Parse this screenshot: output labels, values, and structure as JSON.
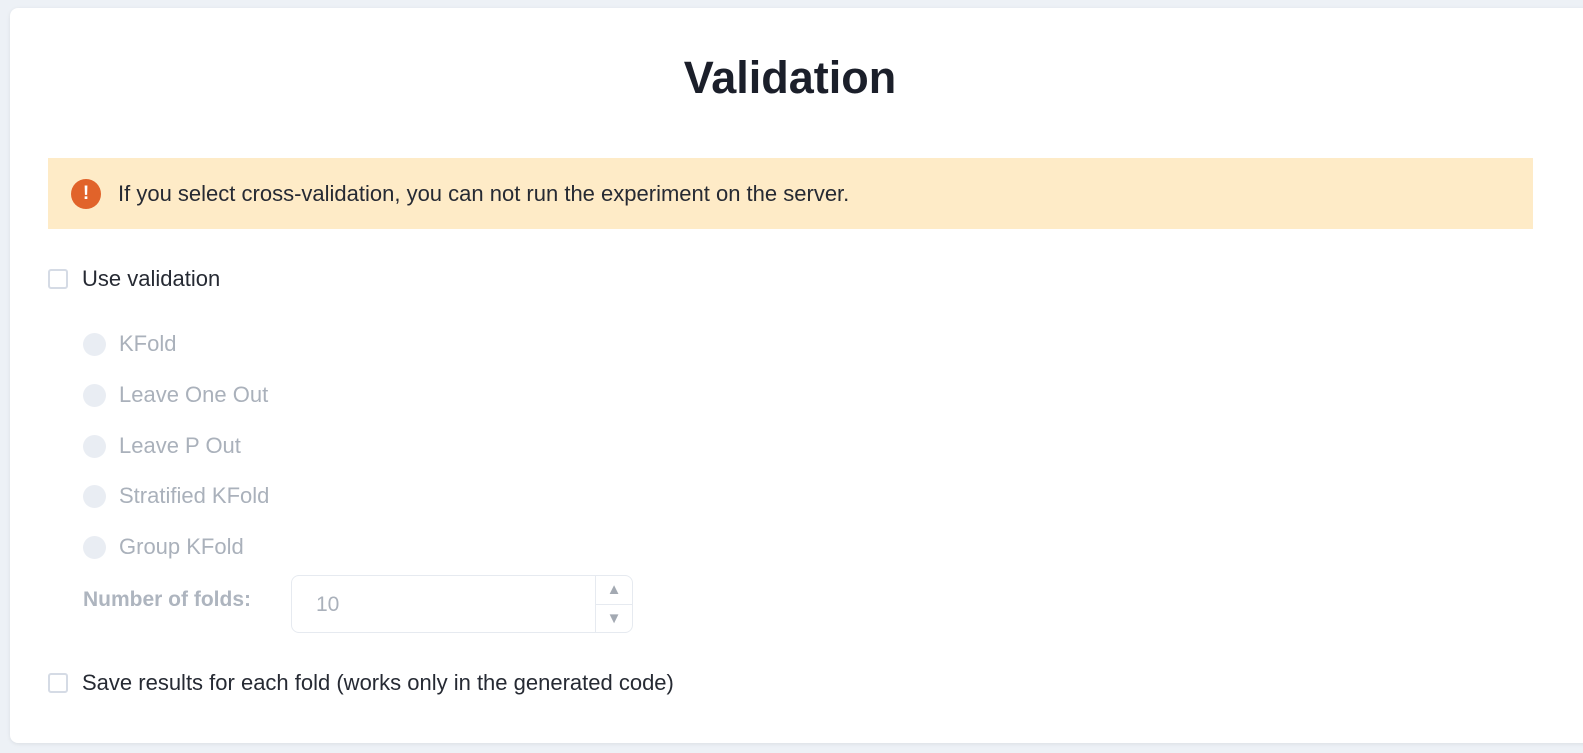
{
  "page": {
    "title": "Validation"
  },
  "alert": {
    "icon": "exclamation-icon",
    "icon_glyph": "!",
    "text": "If you select cross-validation, you can not run the experiment on the server.",
    "bg_color": "#feebc7",
    "icon_color": "#e1632a"
  },
  "use_validation": {
    "label": "Use validation",
    "checked": false
  },
  "methods": {
    "disabled": true,
    "options": [
      {
        "label": "KFold",
        "selected": false
      },
      {
        "label": "Leave One Out",
        "selected": false
      },
      {
        "label": "Leave P Out",
        "selected": false
      },
      {
        "label": "Stratified KFold",
        "selected": false
      },
      {
        "label": "Group KFold",
        "selected": false
      }
    ]
  },
  "folds": {
    "label": "Number of folds:",
    "value": "10",
    "up_glyph": "▲",
    "down_glyph": "▼"
  },
  "save_results": {
    "label": "Save results for each fold (works only in the generated code)",
    "checked": false
  }
}
